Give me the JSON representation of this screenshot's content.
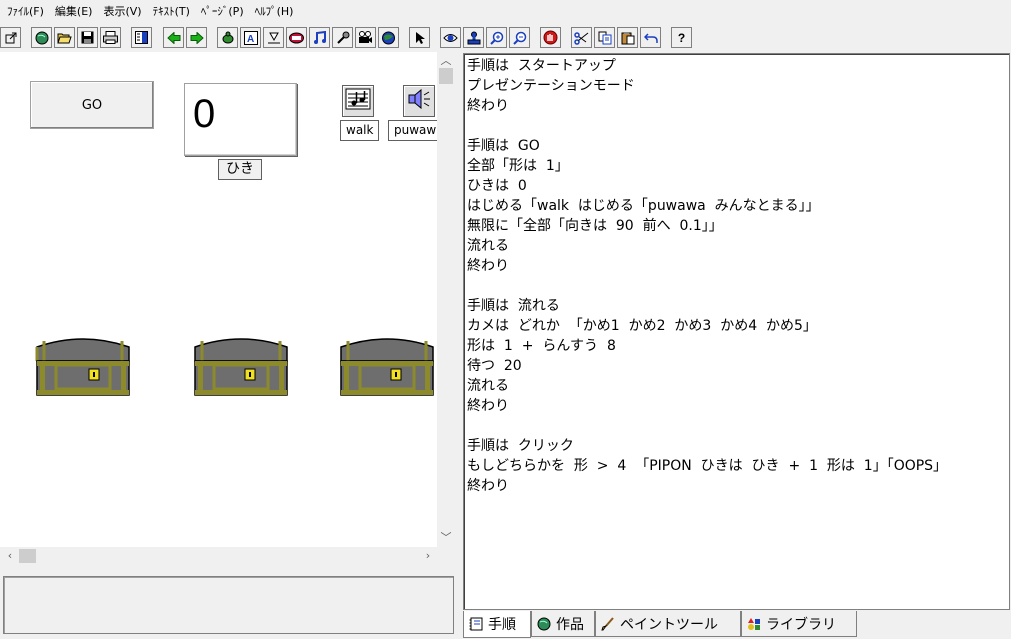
{
  "menu": [
    {
      "label": "ﾌｧｲﾙ(F)"
    },
    {
      "label": "編集(E)"
    },
    {
      "label": "表示(V)"
    },
    {
      "label": "ﾃｷｽﾄ(T)"
    },
    {
      "label": "ﾍﾟｰｼﾞ(P)"
    },
    {
      "label": "ﾍﾙﾌﾟ(H)"
    }
  ],
  "toolbar": {
    "help_label": "?"
  },
  "stage": {
    "go_button_label": "GO",
    "counter_value": "0",
    "counter_label": "ひき",
    "sounds": [
      {
        "label": "walk"
      },
      {
        "label": "puwawa"
      }
    ]
  },
  "script": {
    "lines": [
      "手順は  スタートアップ",
      "プレゼンテーションモード",
      "終わり",
      "",
      "手順は  GO",
      "全部「形は  1」",
      "ひきは  0",
      "はじめる「walk  はじめる「puwawa  みんなとまる」」",
      "無限に「全部「向きは  90  前へ  0.1」」",
      "流れる",
      "終わり",
      "",
      "手順は  流れる",
      "カメは  どれか  「かめ1  かめ2  かめ3  かめ4  かめ5」",
      "形は  1  +  らんすう  8",
      "待つ  20",
      "流れる",
      "終わり",
      "",
      "手順は  クリック",
      "もしどちらかを  形  >  4  「PIPON  ひきは  ひき  +  1  形は  1」「OOPS」",
      "終わり"
    ]
  },
  "tabs": [
    {
      "label": "手順"
    },
    {
      "label": "作品"
    },
    {
      "label": "ペイントツール"
    },
    {
      "label": "ライブラリ"
    }
  ]
}
